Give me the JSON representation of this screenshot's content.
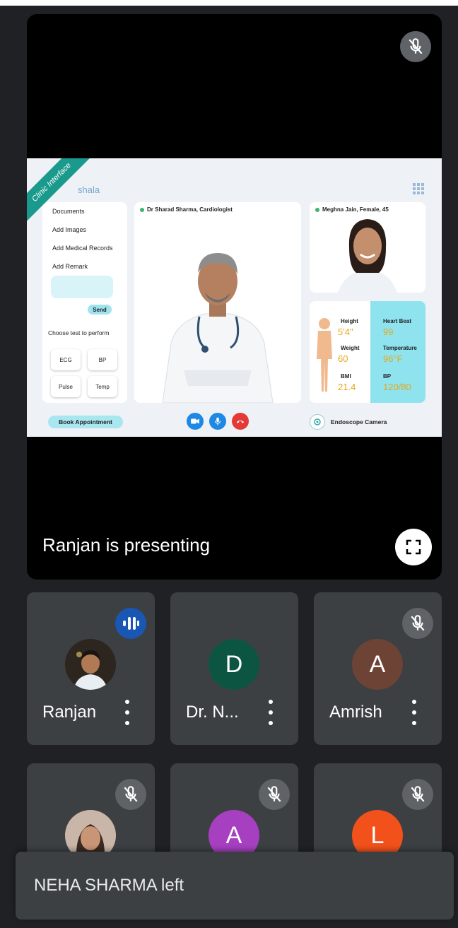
{
  "stage": {
    "presenting_text": "Ranjan is presenting",
    "mic_icon": "mic-off-icon",
    "fullscreen_icon": "fullscreen-icon"
  },
  "shared_screen": {
    "ribbon": "Clinic Interface",
    "brand": "shala",
    "left_menu": [
      "Documents",
      "Add Images",
      "Add Medical Records",
      "Add Remark"
    ],
    "send_label": "Send",
    "choose_label": "Choose test to perform",
    "tests": [
      "ECG",
      "BP",
      "Pulse",
      "Temp"
    ],
    "doctor_label": "Dr Sharad Sharma, Cardiologist",
    "patient_label": "Meghna Jain, Female, 45",
    "vitals": {
      "height_label": "Height",
      "height_value": "5'4\"",
      "weight_label": "Weight",
      "weight_value": "60",
      "bmi_label": "BMI",
      "bmi_value": "21.4",
      "heartbeat_label": "Heart Beat",
      "heartbeat_value": "99",
      "temperature_label": "Temperature",
      "temperature_value": "96°F",
      "bp_label": "BP",
      "bp_value": "120/80"
    },
    "book_label": "Book Appointment",
    "endoscope_label": "Endoscope Camera",
    "colors": {
      "accent": "#1a9a8c",
      "vital_value": "#e6a817",
      "vital_highlight": "#8ee3ef"
    }
  },
  "participants": [
    {
      "name": "Ranjan",
      "initial": "",
      "color": "#6b5a4a",
      "state": "speaking"
    },
    {
      "name": "Dr. N...",
      "initial": "D",
      "color": "#0d5543",
      "state": "normal"
    },
    {
      "name": "Amrish",
      "initial": "A",
      "color": "#6d4335",
      "state": "muted"
    },
    {
      "name": "",
      "initial": "",
      "color": "#8a6a5a",
      "state": "muted"
    },
    {
      "name": "",
      "initial": "A",
      "color": "#a63fc0",
      "state": "muted"
    },
    {
      "name": "",
      "initial": "L",
      "color": "#f2511b",
      "state": "muted"
    }
  ],
  "toast": {
    "text": "NEHA SHARMA left"
  }
}
